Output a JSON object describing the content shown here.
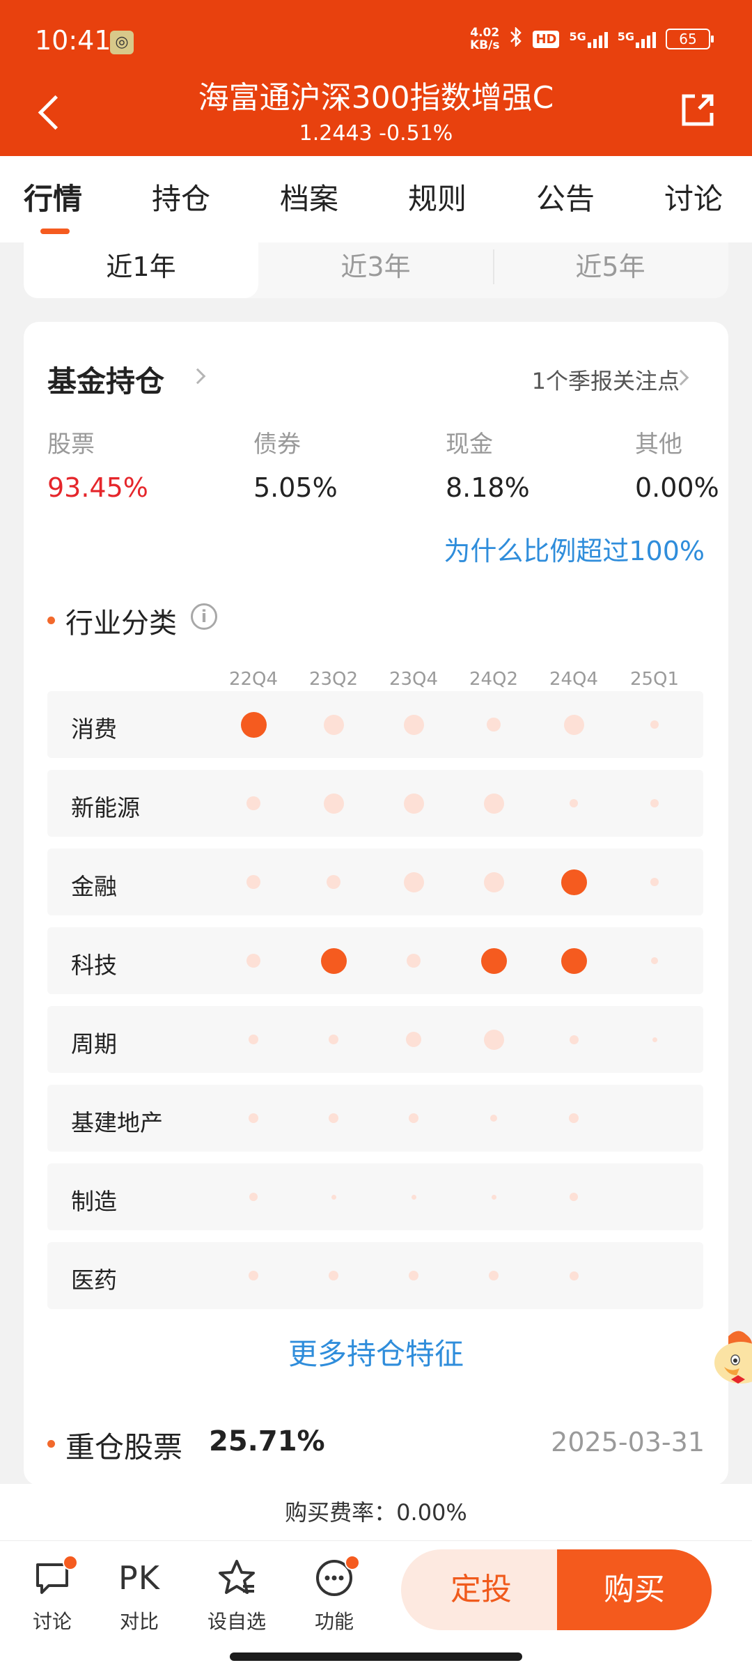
{
  "status_bar": {
    "time": "10:41",
    "net_speed_value": "4.02",
    "net_speed_unit": "KB/s",
    "hd": "HD",
    "sig1": "5G",
    "sig2": "5G",
    "battery": "65"
  },
  "header": {
    "fund_name": "海富通沪深300指数增强C",
    "nav_line": "1.2443 -0.51%"
  },
  "tabs": [
    "行情",
    "持仓",
    "档案",
    "规则",
    "公告",
    "讨论"
  ],
  "period": [
    "近1年",
    "近3年",
    "近5年"
  ],
  "holdings": {
    "title": "基金持仓",
    "report_link": "1个季报关注点",
    "allocation": [
      {
        "label": "股票",
        "value": "93.45%"
      },
      {
        "label": "债券",
        "value": "5.05%"
      },
      {
        "label": "现金",
        "value": "8.18%"
      },
      {
        "label": "其他",
        "value": "0.00%"
      }
    ],
    "why_link": "为什么比例超过100%"
  },
  "industry": {
    "title": "行业分类",
    "info_icon": "i",
    "quarters": [
      "22Q4",
      "23Q2",
      "23Q4",
      "24Q2",
      "24Q4",
      "25Q1"
    ],
    "rows": [
      {
        "name": "消费",
        "levels": [
          4,
          3,
          3,
          2,
          3,
          1
        ]
      },
      {
        "name": "新能源",
        "levels": [
          2,
          3,
          3,
          3,
          1,
          1
        ]
      },
      {
        "name": "金融",
        "levels": [
          2,
          2,
          3,
          3,
          4,
          1
        ]
      },
      {
        "name": "科技",
        "levels": [
          2,
          4,
          2,
          4,
          4,
          0.8
        ]
      },
      {
        "name": "周期",
        "levels": [
          1.3,
          1.3,
          2.2,
          3,
          1.2,
          0.5
        ]
      },
      {
        "name": "基建地产",
        "levels": [
          1.3,
          1.3,
          1.3,
          0.8,
          1.3,
          0
        ]
      },
      {
        "name": "制造",
        "levels": [
          1,
          0.5,
          0.5,
          0.5,
          1,
          0
        ]
      },
      {
        "name": "医药",
        "levels": [
          1.3,
          1.3,
          1.3,
          1.3,
          1.2,
          0
        ]
      }
    ],
    "more_link": "更多持仓特征"
  },
  "heavy": {
    "title": "重仓股票",
    "pct": "25.71%",
    "date": "2025-03-31"
  },
  "fee": "购买费率：0.00%",
  "bottom": {
    "discuss": "讨论",
    "pk_icon": "PK",
    "compare": "对比",
    "watch": "设自选",
    "func": "功能",
    "sip": "定投",
    "buy": "购买"
  },
  "colors": {
    "brand": "#e8410e",
    "accent": "#f45a1d",
    "link": "#2f8ddb",
    "stock_red": "#e5262b",
    "bubble_strong": "#f55b1f",
    "bubble_light": "#fde0d6"
  }
}
